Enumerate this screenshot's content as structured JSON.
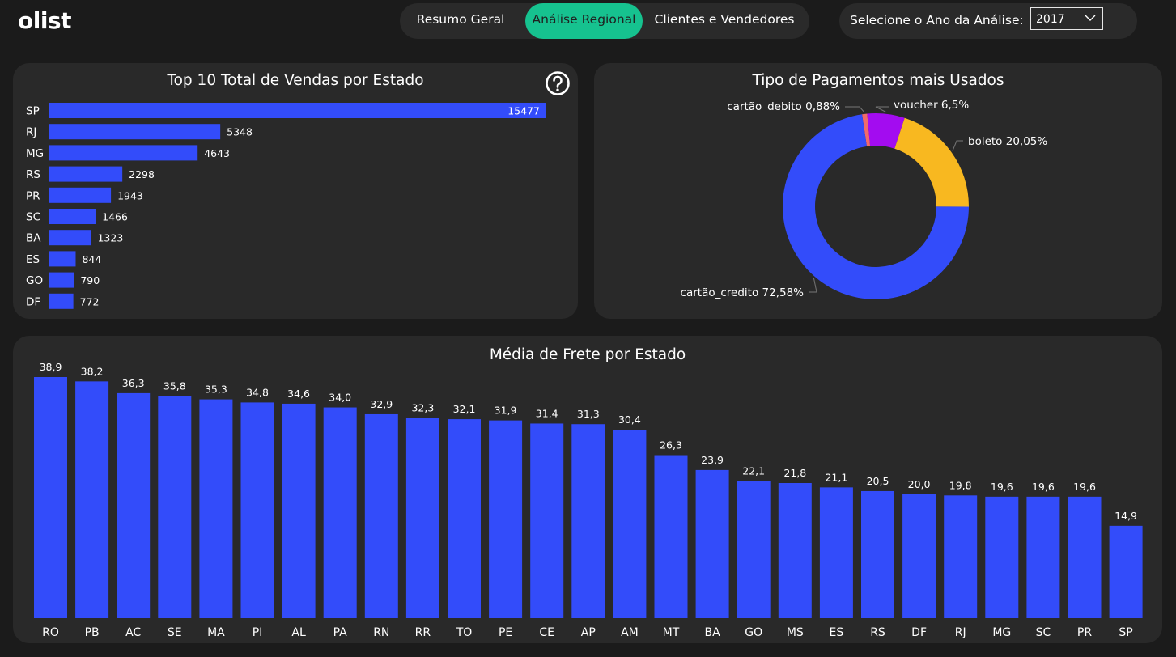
{
  "header": {
    "logo": "olist",
    "tabs": [
      {
        "label": "Resumo Geral",
        "active": false
      },
      {
        "label": "Análise Regional",
        "active": true
      },
      {
        "label": "Clientes e Vendedores",
        "active": false
      }
    ],
    "year_filter": {
      "label": "Selecione o Ano da Análise:",
      "value": "2017"
    }
  },
  "colors": {
    "background": "#1b1b1b",
    "panel": "#292929",
    "accent_tab": "#16c28f",
    "bar": "#334cfa"
  },
  "chart_data": [
    {
      "type": "bar",
      "orientation": "horizontal",
      "title": "Top 10 Total de Vendas por Estado",
      "categories": [
        "SP",
        "RJ",
        "MG",
        "RS",
        "PR",
        "SC",
        "BA",
        "ES",
        "GO",
        "DF"
      ],
      "values": [
        15477,
        5348,
        4643,
        2298,
        1943,
        1466,
        1323,
        844,
        790,
        772
      ],
      "xlim": [
        0,
        15477
      ],
      "grid": false,
      "color": "#334cfa",
      "help_icon": "question-circle-icon"
    },
    {
      "type": "pie",
      "variant": "donut",
      "title": "Tipo de Pagamentos mais Usados",
      "slices": [
        {
          "label": "cartão_credito",
          "text": "cartão_credito 72,58%",
          "value": 72.58,
          "color": "#334cfa"
        },
        {
          "label": "cartão_debito",
          "text": "cartão_debito 0,88%",
          "value": 0.88,
          "color": "#f06a6a"
        },
        {
          "label": "voucher",
          "text": "voucher 6,5%",
          "value": 6.5,
          "color": "#a30cf0"
        },
        {
          "label": "boleto",
          "text": "boleto 20,05%",
          "value": 20.05,
          "color": "#f8b820"
        }
      ]
    },
    {
      "type": "bar",
      "orientation": "vertical",
      "title": "Média de Frete por Estado",
      "categories": [
        "RO",
        "PB",
        "AC",
        "SE",
        "MA",
        "PI",
        "AL",
        "PA",
        "RN",
        "RR",
        "TO",
        "PE",
        "CE",
        "AP",
        "AM",
        "MT",
        "BA",
        "GO",
        "MS",
        "ES",
        "RS",
        "DF",
        "RJ",
        "MG",
        "SC",
        "PR",
        "SP"
      ],
      "values": [
        38.9,
        38.2,
        36.3,
        35.8,
        35.3,
        34.8,
        34.6,
        34.0,
        32.9,
        32.3,
        32.1,
        31.9,
        31.4,
        31.3,
        30.4,
        26.3,
        23.9,
        22.1,
        21.8,
        21.1,
        20.5,
        20.0,
        19.8,
        19.6,
        19.6,
        19.6,
        14.9
      ],
      "labels": [
        "38,9",
        "38,2",
        "36,3",
        "35,8",
        "35,3",
        "34,8",
        "34,6",
        "34,0",
        "32,9",
        "32,3",
        "32,1",
        "31,9",
        "31,4",
        "31,3",
        "30,4",
        "26,3",
        "23,9",
        "22,1",
        "21,8",
        "21,1",
        "20,5",
        "20,0",
        "19,8",
        "19,6",
        "19,6",
        "19,6",
        "14,9"
      ],
      "ylim": [
        0,
        38.9
      ],
      "grid": false,
      "color": "#334cfa"
    }
  ]
}
